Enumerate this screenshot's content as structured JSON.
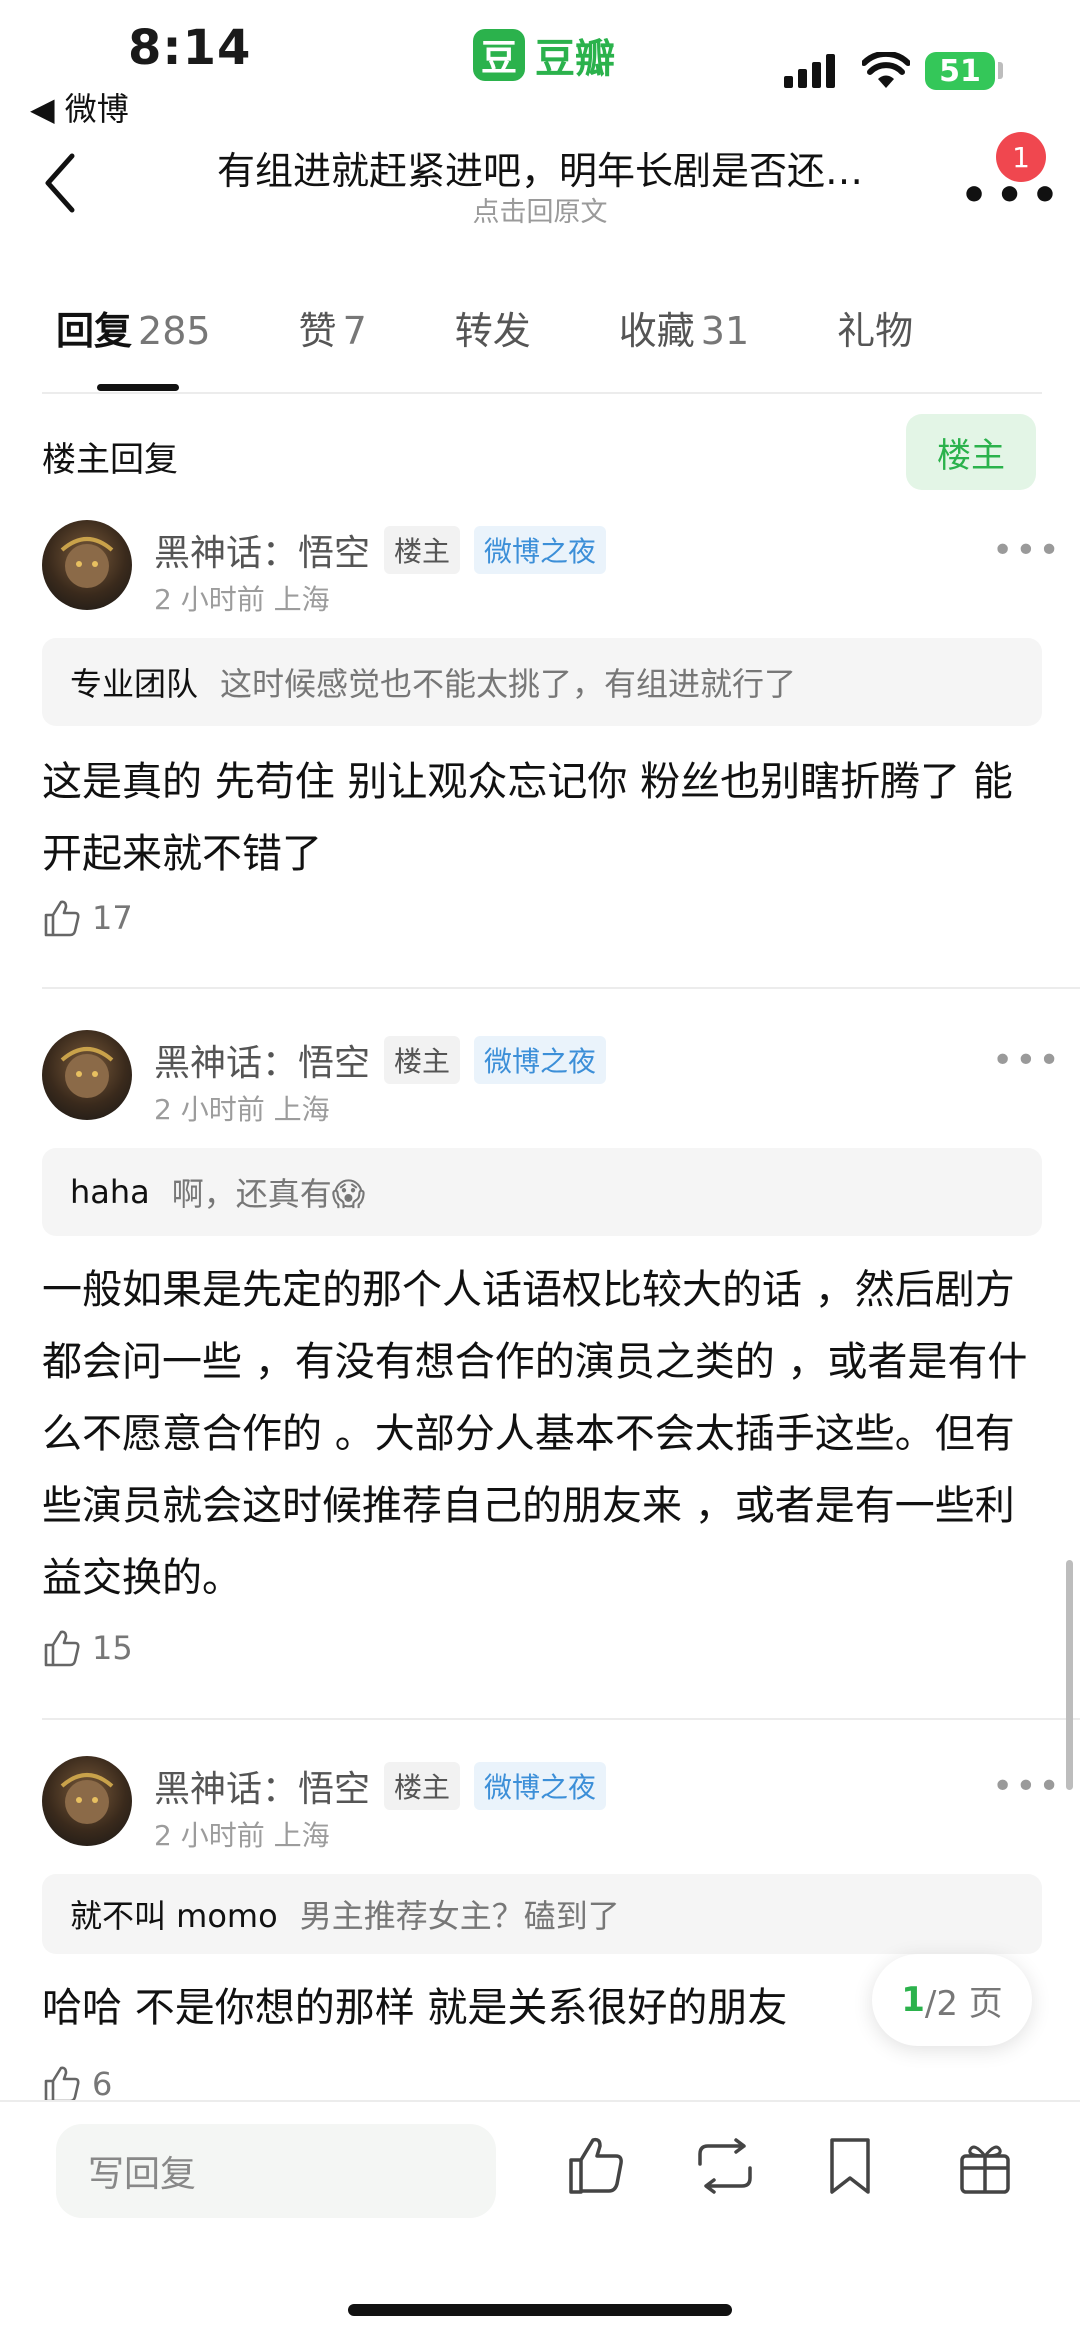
{
  "status_bar": {
    "time": "8:14",
    "back_app": "◀ 微博",
    "battery": "51"
  },
  "app": {
    "logo_char": "豆",
    "name": "豆瓣"
  },
  "nav": {
    "title": "有组进就赶紧进吧，明年长剧是否还…",
    "subtitle": "点击回原文",
    "badge": "1"
  },
  "tabs": [
    {
      "label": "回复",
      "count": "285",
      "active": true
    },
    {
      "label": "赞",
      "count": "7"
    },
    {
      "label": "转发",
      "count": ""
    },
    {
      "label": "收藏",
      "count": "31"
    },
    {
      "label": "礼物",
      "count": ""
    }
  ],
  "section": {
    "title": "楼主回复",
    "filter": "楼主"
  },
  "comments": [
    {
      "user": "黑神话：悟空",
      "tag_op": "楼主",
      "tag_event": "微博之夜",
      "meta": "2 小时前 上海",
      "quote_user": "专业团队",
      "quote_text": "这时候感觉也不能太挑了，有组进就行了",
      "text": "这是真的 先苟住 别让观众忘记你 粉丝也别瞎折腾了 能开起来就不错了",
      "likes": "17"
    },
    {
      "user": "黑神话：悟空",
      "tag_op": "楼主",
      "tag_event": "微博之夜",
      "meta": "2 小时前 上海",
      "quote_user": "haha",
      "quote_text": "啊，还真有😱",
      "text": "一般如果是先定的那个人话语权比较大的话 ，然后剧方都会问一些 ，有没有想合作的演员之类的 ，或者是有什么不愿意合作的 。大部分人基本不会太插手这些。但有些演员就会这时候推荐自己的朋友来 ，或者是有一些利益交换的。",
      "likes": "15"
    },
    {
      "user": "黑神话：悟空",
      "tag_op": "楼主",
      "tag_event": "微博之夜",
      "meta": "2 小时前 上海",
      "quote_user": "就不叫 momo",
      "quote_text": "男主推荐女主？磕到了",
      "text": "哈哈 不是你想的那样 就是关系很好的朋友",
      "likes": "6"
    }
  ],
  "pager": {
    "current": "1",
    "total": "/2 页"
  },
  "bottom": {
    "reply_placeholder": "写回复"
  },
  "colors": {
    "brand_green": "#2bb24c",
    "badge_red": "#f0474f",
    "tag_blue": "#3c8fd8"
  }
}
